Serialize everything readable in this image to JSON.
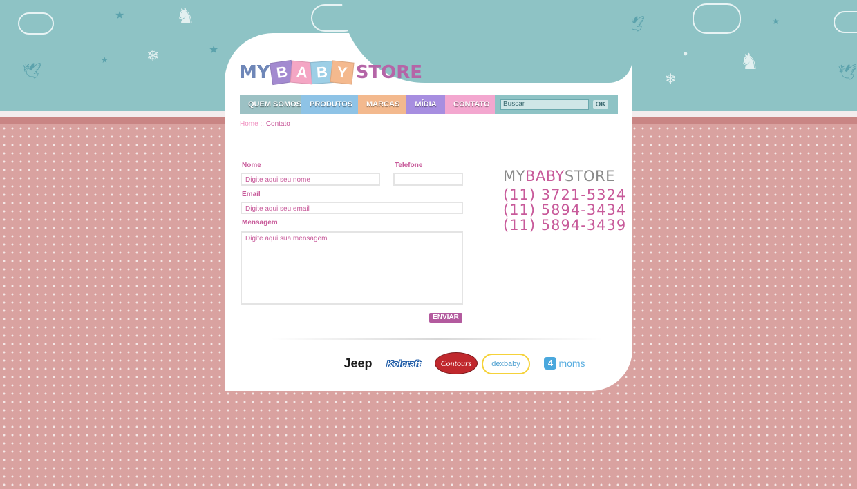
{
  "header": {
    "logo": {
      "my": "MY",
      "baby": [
        "B",
        "A",
        "B",
        "Y"
      ],
      "store": "STORE"
    }
  },
  "nav": {
    "items": [
      {
        "label": "QUEM SOMOS",
        "color": "#9cc1c4"
      },
      {
        "label": "PRODUTOS",
        "color": "#8ec3e6"
      },
      {
        "label": "MARCAS",
        "color": "#f3b98e"
      },
      {
        "label": "MÍDIA",
        "color": "#a78ee0"
      },
      {
        "label": "CONTATO",
        "color": "#f3a7cf"
      }
    ],
    "search": {
      "placeholder": "Buscar",
      "button": "OK"
    }
  },
  "breadcrumb": {
    "home": "Home",
    "separator": " :: ",
    "current": "Contato"
  },
  "form": {
    "name_label": "Nome",
    "name_placeholder": "Digite aqui seu nome",
    "phone_label": "Telefone",
    "phone_value": "",
    "email_label": "Email",
    "email_placeholder": "Digite aqui seu email",
    "message_label": "Mensagem",
    "message_placeholder": "Digite aqui sua mensagem",
    "submit": "ENVIAR"
  },
  "contact": {
    "brand_a": "MY",
    "brand_b": "BABY",
    "brand_c": "STORE",
    "phones": [
      "(11) 3721-5324",
      "(11) 5894-3434",
      "(11) 5894-3439"
    ]
  },
  "brands": {
    "jeep": "Jeep",
    "kolcraft": "Kolcraft",
    "contours": "Contours",
    "dexbaby": "dexbaby",
    "fourmoms_badge": "4",
    "fourmoms_text": "moms"
  },
  "colors": {
    "sky": "#8ec3c5",
    "background": "#d9a2a0",
    "accent": "#c85a9a"
  }
}
